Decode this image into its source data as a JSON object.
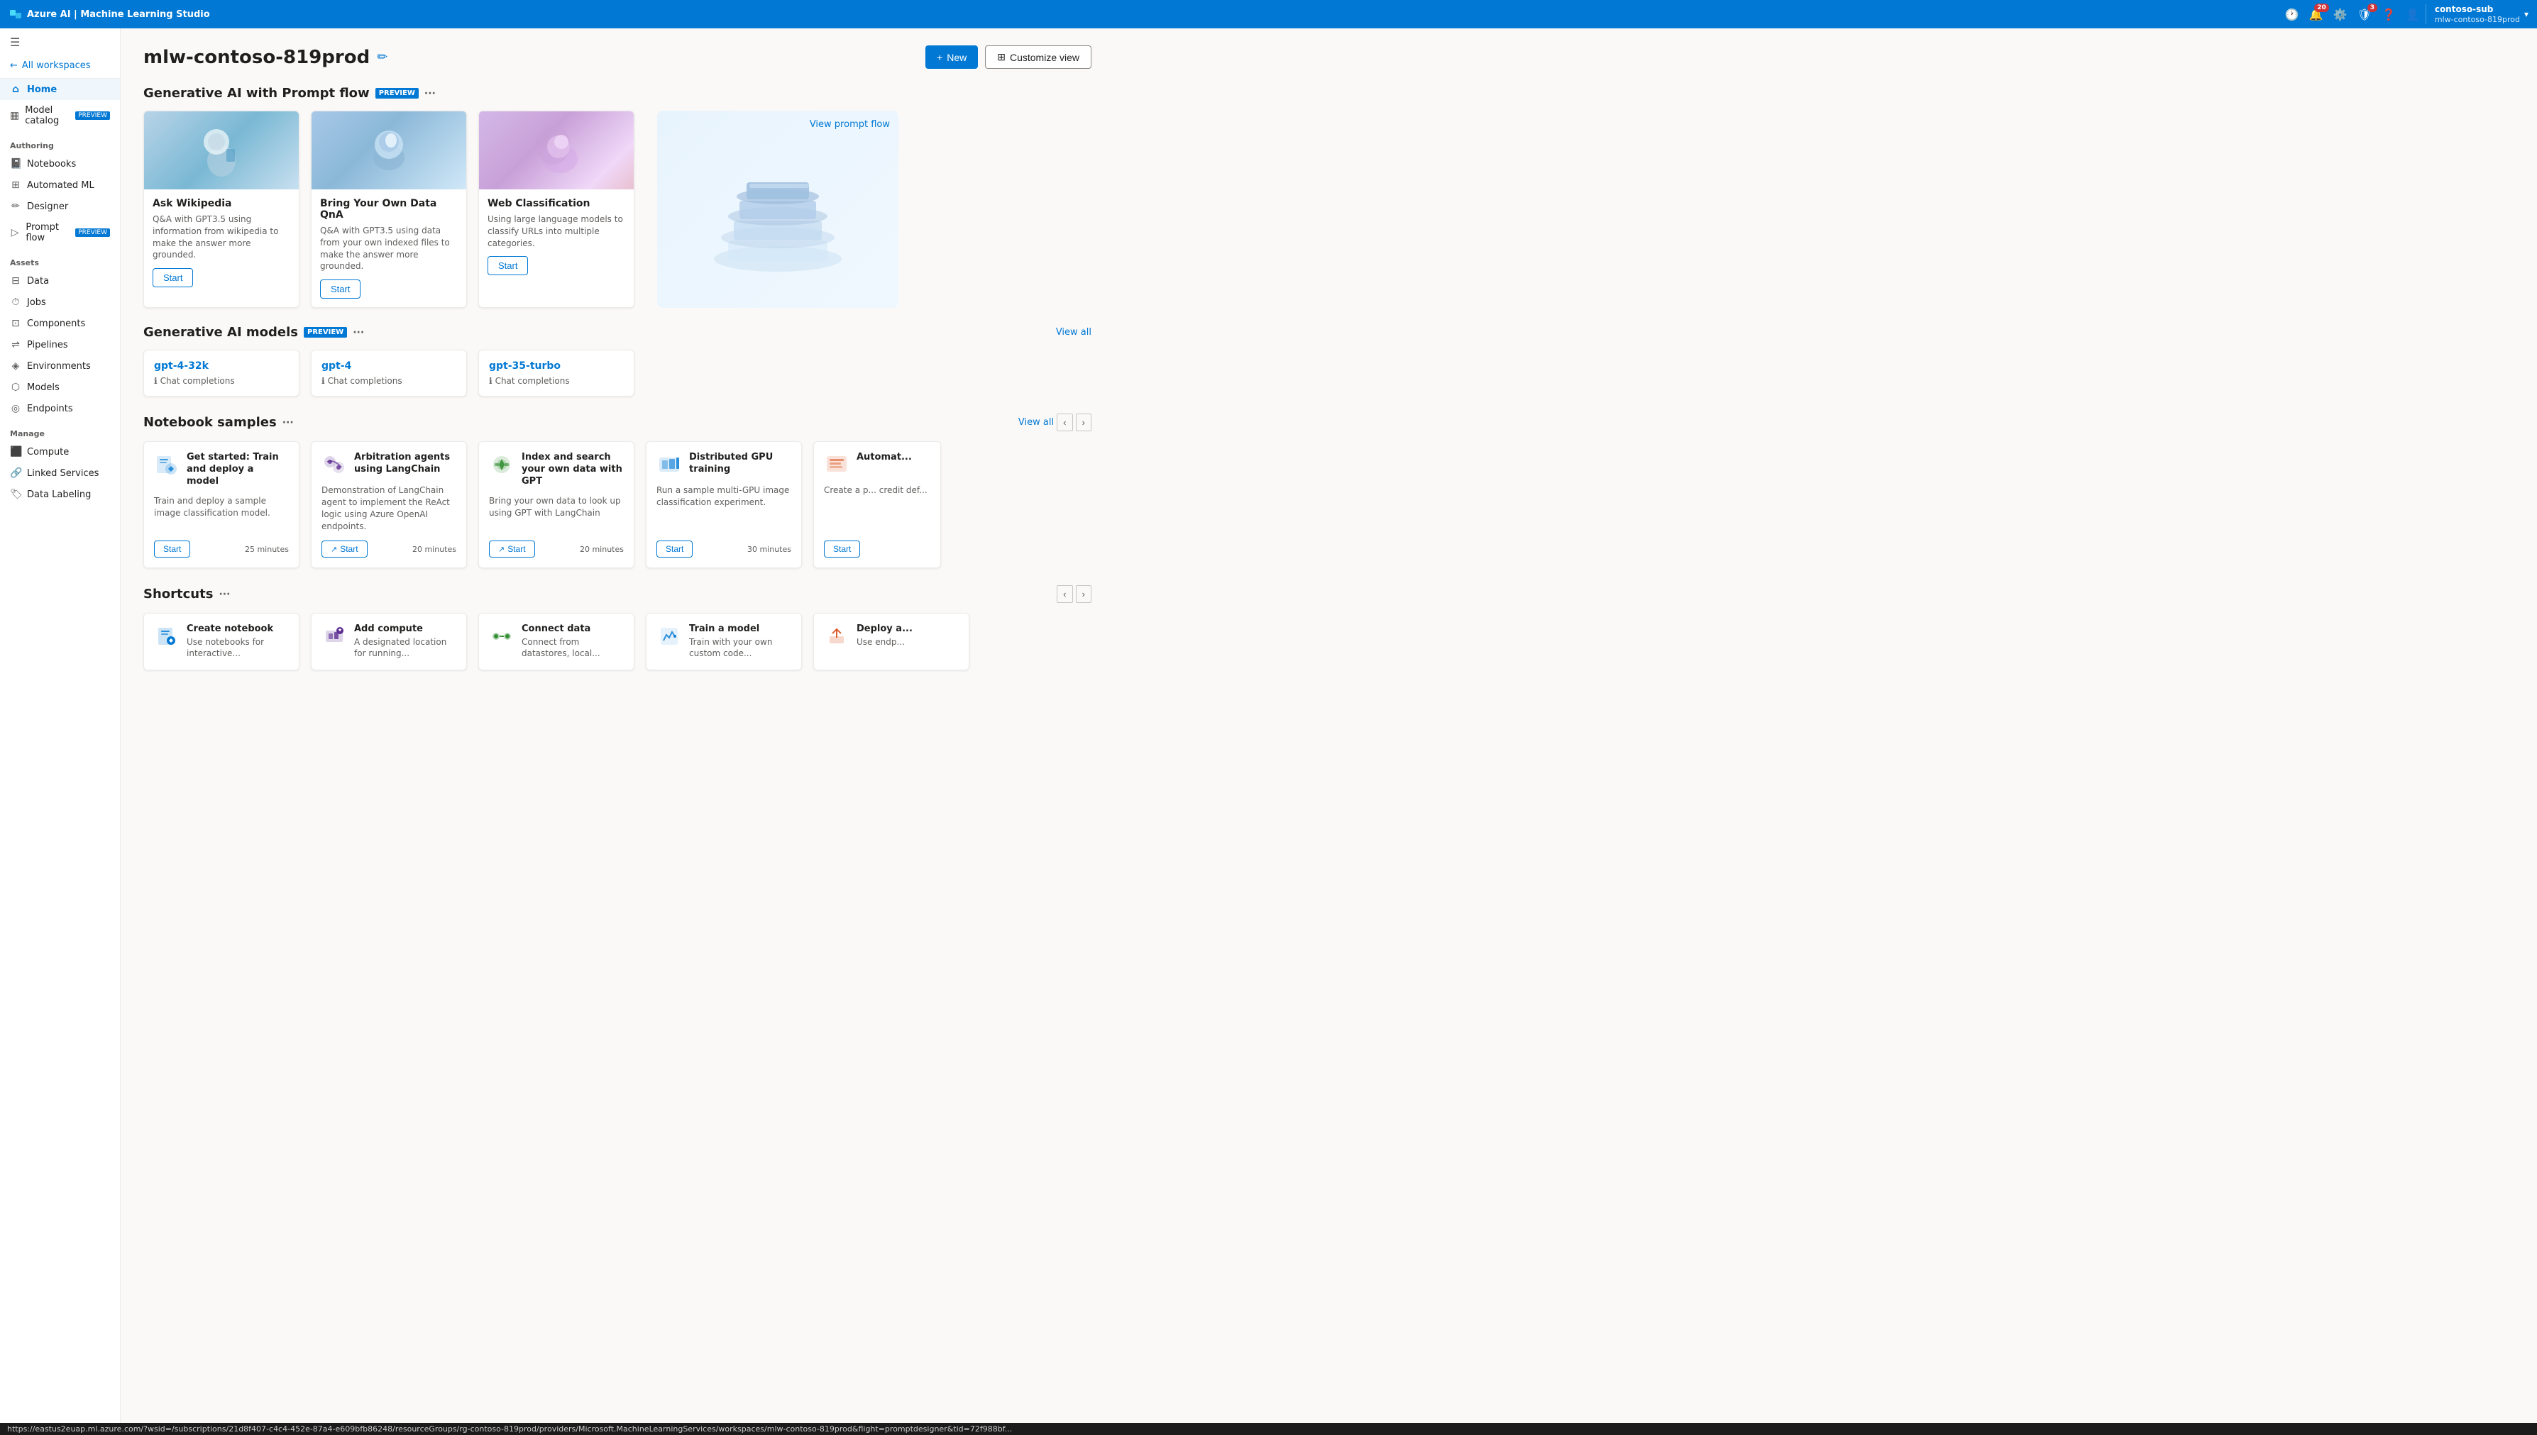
{
  "topbar": {
    "app_name": "Azure AI | Machine Learning Studio",
    "user_account": "contoso-sub",
    "user_workspace": "mlw-contoso-819prod",
    "notification_count": "20",
    "alert_count": "3"
  },
  "sidebar": {
    "back_label": "All workspaces",
    "home_label": "Home",
    "model_catalog_label": "Model catalog",
    "model_catalog_preview": "PREVIEW",
    "authoring_label": "Authoring",
    "notebooks_label": "Notebooks",
    "automated_ml_label": "Automated ML",
    "designer_label": "Designer",
    "prompt_flow_label": "Prompt flow",
    "prompt_flow_preview": "PREVIEW",
    "assets_label": "Assets",
    "data_label": "Data",
    "jobs_label": "Jobs",
    "components_label": "Components",
    "pipelines_label": "Pipelines",
    "environments_label": "Environments",
    "models_label": "Models",
    "endpoints_label": "Endpoints",
    "manage_label": "Manage",
    "compute_label": "Compute",
    "linked_services_label": "Linked Services",
    "data_labeling_label": "Data Labeling"
  },
  "page": {
    "title": "mlw-contoso-819prod",
    "new_button": "New",
    "customize_button": "Customize view"
  },
  "generative_ai_section": {
    "title": "Generative AI with Prompt flow",
    "preview_badge": "PREVIEW",
    "view_prompt_flow": "View prompt flow",
    "cards": [
      {
        "title": "Ask Wikipedia",
        "description": "Q&A with GPT3.5 using information from wikipedia to make the answer more grounded.",
        "start_label": "Start",
        "img_class": "img-wiki"
      },
      {
        "title": "Bring Your Own Data QnA",
        "description": "Q&A with GPT3.5 using data from your own indexed files to make the answer more grounded.",
        "start_label": "Start",
        "img_class": "img-byod"
      },
      {
        "title": "Web Classification",
        "description": "Using large language models to classify URLs into multiple categories.",
        "start_label": "Start",
        "img_class": "img-webclass"
      }
    ]
  },
  "ai_models_section": {
    "title": "Generative AI models",
    "preview_badge": "PREVIEW",
    "view_all_label": "View all",
    "models": [
      {
        "name": "gpt-4-32k",
        "type": "Chat completions"
      },
      {
        "name": "gpt-4",
        "type": "Chat completions"
      },
      {
        "name": "gpt-35-turbo",
        "type": "Chat completions"
      }
    ]
  },
  "notebook_samples_section": {
    "title": "Notebook samples",
    "view_all_label": "View all",
    "notebooks": [
      {
        "title": "Get started: Train and deploy a model",
        "description": "Train and deploy a sample image classification model.",
        "duration": "25 minutes",
        "start_label": "Start"
      },
      {
        "title": "Arbitration agents using LangChain",
        "description": "Demonstration of LangChain agent to implement the ReAct logic using Azure OpenAI endpoints.",
        "duration": "20 minutes",
        "start_label": "Start"
      },
      {
        "title": "Index and search your own data with GPT",
        "description": "Bring your own data to look up using GPT with LangChain",
        "duration": "20 minutes",
        "start_label": "Start"
      },
      {
        "title": "Distributed GPU training",
        "description": "Run a sample multi-GPU image classification experiment.",
        "duration": "30 minutes",
        "start_label": "Start"
      },
      {
        "title": "Automat...",
        "description": "Create a p... credit def...",
        "duration": "",
        "start_label": "Start"
      }
    ]
  },
  "shortcuts_section": {
    "title": "Shortcuts",
    "shortcuts": [
      {
        "title": "Create notebook",
        "description": "Use notebooks for interactive..."
      },
      {
        "title": "Add compute",
        "description": "A designated location for running..."
      },
      {
        "title": "Connect data",
        "description": "Connect from datastores, local..."
      },
      {
        "title": "Train a model",
        "description": "Train with your own custom code..."
      },
      {
        "title": "Deploy a...",
        "description": "Use endp..."
      }
    ]
  },
  "status_bar": {
    "url": "https://eastus2euap.ml.azure.com/?wsid=/subscriptions/21d8f407-c4c4-452e-87a4-e609bfb86248/resourceGroups/rg-contoso-819prod/providers/Microsoft.MachineLearningServices/workspaces/mlw-contoso-819prod&flight=promptdesigner&tid=72f988bf..."
  }
}
